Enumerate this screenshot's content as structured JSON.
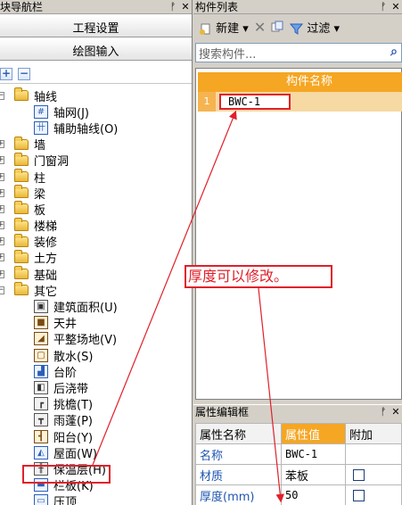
{
  "left_panel": {
    "title": "块导航栏",
    "pin_glyph": "ᚡ",
    "close_glyph": "✕",
    "buttons": [
      "工程设置",
      "绘图输入"
    ],
    "tree": [
      {
        "label": "轴线",
        "type": "folder",
        "expanded": true
      },
      {
        "label": "轴网(J)",
        "type": "item",
        "icon": "grid-icon"
      },
      {
        "label": "辅助轴线(O)",
        "type": "item",
        "icon": "aux-axis-icon"
      },
      {
        "label": "墙",
        "type": "folder"
      },
      {
        "label": "门窗洞",
        "type": "folder"
      },
      {
        "label": "柱",
        "type": "folder"
      },
      {
        "label": "梁",
        "type": "folder"
      },
      {
        "label": "板",
        "type": "folder"
      },
      {
        "label": "楼梯",
        "type": "folder"
      },
      {
        "label": "装修",
        "type": "folder"
      },
      {
        "label": "土方",
        "type": "folder"
      },
      {
        "label": "基础",
        "type": "folder"
      },
      {
        "label": "其它",
        "type": "folder",
        "expanded": true
      },
      {
        "label": "建筑面积(U)",
        "type": "item",
        "icon": "area-icon"
      },
      {
        "label": "天井",
        "type": "item",
        "icon": "patio-icon"
      },
      {
        "label": "平整场地(V)",
        "type": "item",
        "icon": "site-leveling-icon"
      },
      {
        "label": "散水(S)",
        "type": "item",
        "icon": "apron-icon"
      },
      {
        "label": "台阶",
        "type": "item",
        "icon": "steps-icon"
      },
      {
        "label": "后浇带",
        "type": "item",
        "icon": "post-pour-strip-icon"
      },
      {
        "label": "挑檐(T)",
        "type": "item",
        "icon": "eave-icon"
      },
      {
        "label": "雨蓬(P)",
        "type": "item",
        "icon": "canopy-icon"
      },
      {
        "label": "阳台(Y)",
        "type": "item",
        "icon": "balcony-icon"
      },
      {
        "label": "屋面(W)",
        "type": "item",
        "icon": "roof-icon"
      },
      {
        "label": "保温层(H)",
        "type": "item",
        "icon": "insulation-icon",
        "highlighted": true
      },
      {
        "label": "栏板(K)",
        "type": "item",
        "icon": "parapet-icon"
      },
      {
        "label": "压顶",
        "type": "item",
        "icon": "coping-icon"
      }
    ]
  },
  "right_panel": {
    "title": "构件列表",
    "toolbar": {
      "new_label": "新建",
      "filter_label": "过滤"
    },
    "search_placeholder": "搜索构件...",
    "grid": {
      "header": "构件名称",
      "rows": [
        {
          "num": "1",
          "name": "BWC-1"
        }
      ]
    },
    "props": {
      "title": "属性编辑框",
      "headers": [
        "属性名称",
        "属性值",
        "附加"
      ],
      "rows": [
        {
          "name": "名称",
          "value": "BWC-1",
          "checkbox": false
        },
        {
          "name": "材质",
          "value": "苯板",
          "checkbox": true
        },
        {
          "name": "厚度(mm)",
          "value": "50",
          "checkbox": true
        }
      ]
    }
  },
  "annotation": {
    "text": "厚度可以修改。",
    "color": "#e0202a"
  },
  "colors": {
    "accent_orange": "#f5a623",
    "selection_row": "#f6d9a3",
    "annotation_red": "#e0202a"
  }
}
